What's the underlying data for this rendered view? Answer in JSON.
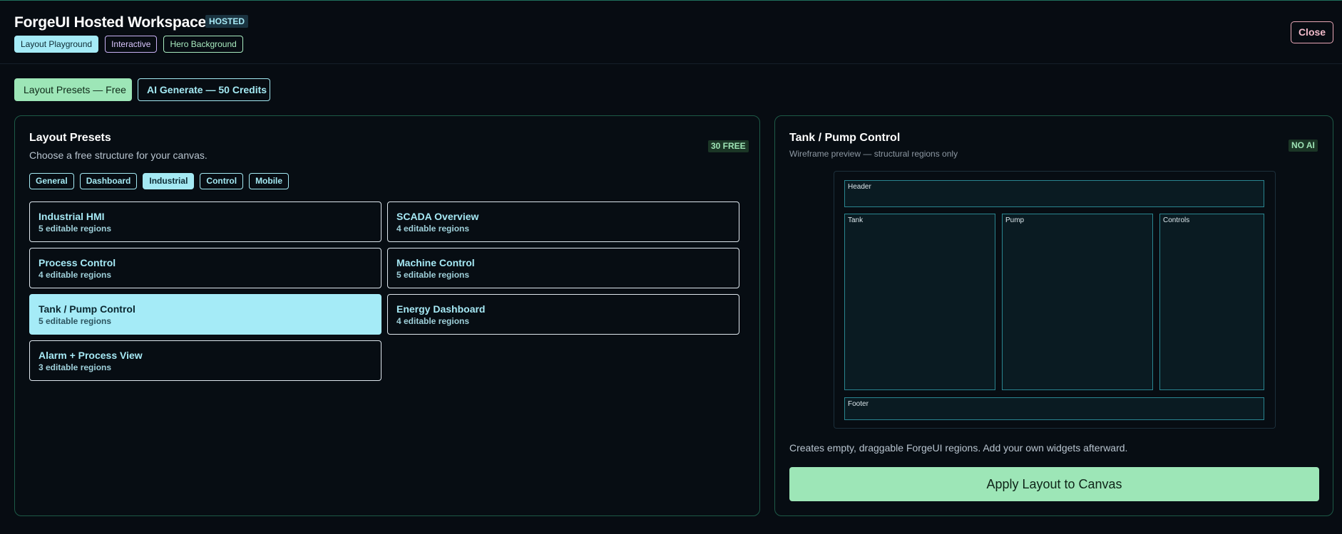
{
  "header": {
    "title": "ForgeUI Hosted Workspace",
    "badge": "HOSTED",
    "chips": [
      "Layout Playground",
      "Interactive",
      "Hero Background"
    ],
    "close_label": "Close"
  },
  "modes": {
    "presets_label": "Layout Presets — Free",
    "ai_label": "AI Generate — 50 Credits"
  },
  "presets_panel": {
    "title": "Layout Presets",
    "subtitle": "Choose a free structure for your canvas.",
    "badge": "30 FREE",
    "filters": [
      "General",
      "Dashboard",
      "Industrial",
      "Control",
      "Mobile"
    ],
    "active_filter": "Industrial",
    "items": [
      {
        "name": "Industrial HMI",
        "regions": "5 editable regions"
      },
      {
        "name": "SCADA Overview",
        "regions": "4 editable regions"
      },
      {
        "name": "Process Control",
        "regions": "4 editable regions"
      },
      {
        "name": "Machine Control",
        "regions": "5 editable regions"
      },
      {
        "name": "Tank / Pump Control",
        "regions": "5 editable regions",
        "selected": true
      },
      {
        "name": "Energy Dashboard",
        "regions": "4 editable regions"
      },
      {
        "name": "Alarm + Process View",
        "regions": "3 editable regions"
      }
    ]
  },
  "preview": {
    "title": "Tank / Pump Control",
    "subtitle": "Wireframe preview — structural regions only",
    "badge": "NO AI",
    "regions": [
      "Header",
      "Tank",
      "Pump",
      "Controls",
      "Footer"
    ],
    "note": "Creates empty, draggable ForgeUI regions. Add your own widgets afterward.",
    "apply_label": "Apply Layout to Canvas"
  },
  "colors": {
    "background": "#070c12",
    "accent_cyan": "#a5ebf7",
    "accent_green": "#9de6b7",
    "accent_purple": "#c9b2f5",
    "danger_pink": "#e9a7b6",
    "panel_border": "#1d5a47"
  }
}
